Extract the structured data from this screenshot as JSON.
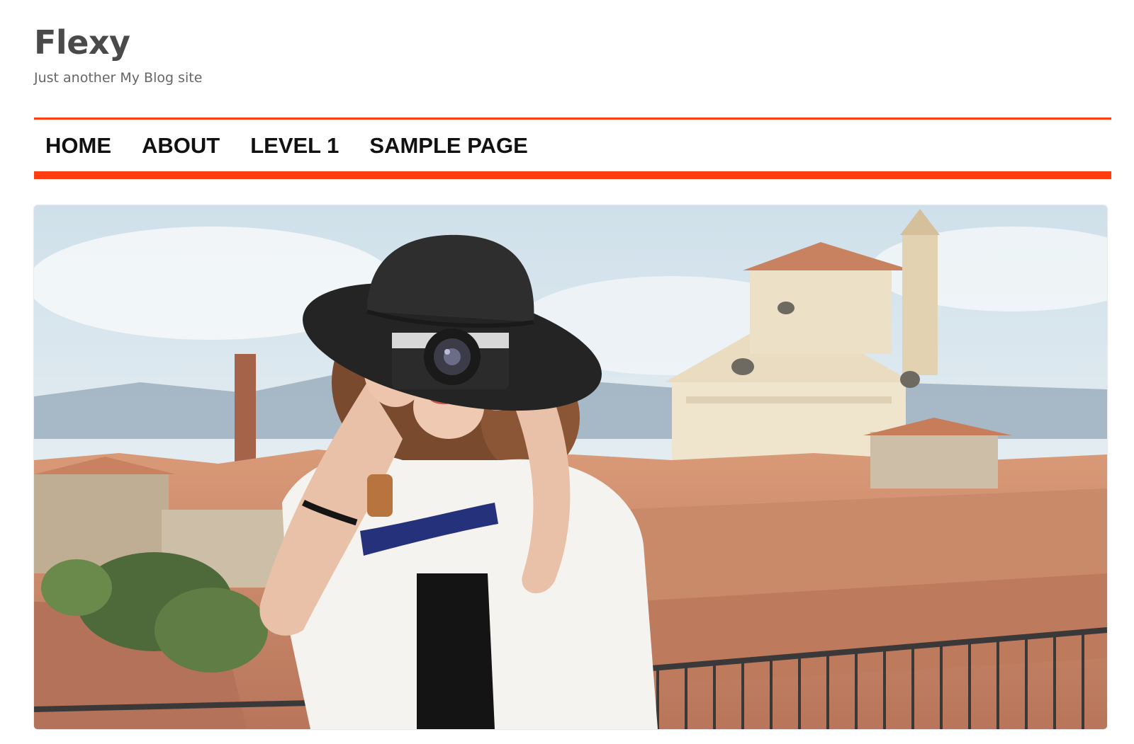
{
  "site": {
    "title": "Flexy",
    "tagline": "Just another My Blog site"
  },
  "nav": {
    "items": [
      {
        "label": "HOME"
      },
      {
        "label": "ABOUT"
      },
      {
        "label": "LEVEL 1"
      },
      {
        "label": "SAMPLE PAGE"
      }
    ]
  },
  "colors": {
    "accent": "#ff3d12",
    "title": "#4a4a4a",
    "tagline": "#666666",
    "nav_text": "#111111"
  },
  "hero": {
    "icon": "hero-photo-woman-with-camera"
  }
}
